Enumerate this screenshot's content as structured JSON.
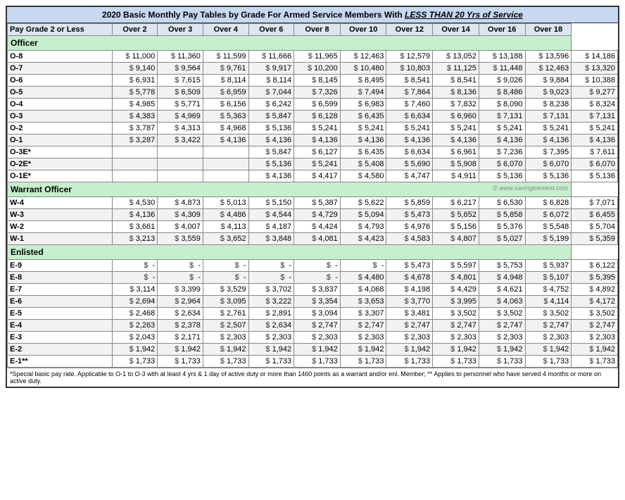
{
  "title": {
    "main": "2020 Basic Monthly Pay Tables by Grade For Armed Service Members",
    "highlight": "LESS THAN 20 Yrs of Service"
  },
  "columns": [
    "Pay Grade 2 or Less",
    "Over 2",
    "Over 3",
    "Over 4",
    "Over 6",
    "Over 8",
    "Over 10",
    "Over 12",
    "Over 14",
    "Over 16",
    "Over 18"
  ],
  "sections": {
    "officer": {
      "label": "Officer",
      "rows": [
        {
          "grade": "O-8",
          "values": [
            "11,000",
            "11,360",
            "11,599",
            "11,666",
            "11,965",
            "12,463",
            "12,579",
            "13,052",
            "13,188",
            "13,596",
            "14,186"
          ]
        },
        {
          "grade": "O-7",
          "values": [
            "9,140",
            "9,564",
            "9,761",
            "9,917",
            "10,200",
            "10,480",
            "10,803",
            "11,125",
            "11,448",
            "12,463",
            "13,320"
          ]
        },
        {
          "grade": "O-6",
          "values": [
            "6,931",
            "7,615",
            "8,114",
            "8,114",
            "8,145",
            "8,495",
            "8,541",
            "8,541",
            "9,026",
            "9,884",
            "10,388"
          ]
        },
        {
          "grade": "O-5",
          "values": [
            "5,778",
            "6,509",
            "6,959",
            "7,044",
            "7,326",
            "7,494",
            "7,864",
            "8,136",
            "8,486",
            "9,023",
            "9,277"
          ]
        },
        {
          "grade": "O-4",
          "values": [
            "4,985",
            "5,771",
            "6,156",
            "6,242",
            "6,599",
            "6,983",
            "7,460",
            "7,832",
            "8,090",
            "8,238",
            "8,324"
          ]
        },
        {
          "grade": "O-3",
          "values": [
            "4,383",
            "4,969",
            "5,363",
            "5,847",
            "6,128",
            "6,435",
            "6,634",
            "6,960",
            "7,131",
            "7,131",
            "7,131"
          ]
        },
        {
          "grade": "O-2",
          "values": [
            "3,787",
            "4,313",
            "4,968",
            "5,136",
            "5,241",
            "5,241",
            "5,241",
            "5,241",
            "5,241",
            "5,241",
            "5,241"
          ]
        },
        {
          "grade": "O-1",
          "values": [
            "3,287",
            "3,422",
            "4,136",
            "4,136",
            "4,136",
            "4,136",
            "4,136",
            "4,136",
            "4,136",
            "4,136",
            "4,136"
          ]
        },
        {
          "grade": "O-3E*",
          "values": [
            "",
            "",
            "",
            "5,847",
            "6,127",
            "6,435",
            "6,634",
            "6,961",
            "7,236",
            "7,395",
            "7,611"
          ]
        },
        {
          "grade": "O-2E*",
          "values": [
            "",
            "",
            "",
            "5,136",
            "5,241",
            "5,408",
            "5,690",
            "5,908",
            "6,070",
            "6,070",
            "6,070"
          ]
        },
        {
          "grade": "O-1E*",
          "values": [
            "",
            "",
            "",
            "4,136",
            "4,417",
            "4,580",
            "4,747",
            "4,911",
            "5,136",
            "5,136",
            "5,136"
          ]
        }
      ]
    },
    "warrant": {
      "label": "Warrant Officer",
      "watermark": "© www.savingtoinvest.com",
      "rows": [
        {
          "grade": "W-4",
          "values": [
            "4,530",
            "4,873",
            "5,013",
            "5,150",
            "5,387",
            "5,622",
            "5,859",
            "6,217",
            "6,530",
            "6,828",
            "7,071"
          ]
        },
        {
          "grade": "W-3",
          "values": [
            "4,136",
            "4,309",
            "4,486",
            "4,544",
            "4,729",
            "5,094",
            "5,473",
            "5,652",
            "5,858",
            "6,072",
            "6,455"
          ]
        },
        {
          "grade": "W-2",
          "values": [
            "3,661",
            "4,007",
            "4,113",
            "4,187",
            "4,424",
            "4,793",
            "4,976",
            "5,156",
            "5,376",
            "5,548",
            "5,704"
          ]
        },
        {
          "grade": "W-1",
          "values": [
            "3,213",
            "3,559",
            "3,652",
            "3,848",
            "4,081",
            "4,423",
            "4,583",
            "4,807",
            "5,027",
            "5,199",
            "5,359"
          ]
        }
      ]
    },
    "enlisted": {
      "label": "Enlisted",
      "rows": [
        {
          "grade": "E-9",
          "values": [
            "-",
            "-",
            "-",
            "-",
            "-",
            "-",
            "5,473",
            "5,597",
            "5,753",
            "5,937",
            "6,122"
          ]
        },
        {
          "grade": "E-8",
          "values": [
            "-",
            "-",
            "-",
            "-",
            "-",
            "4,480",
            "4,678",
            "4,801",
            "4,948",
            "5,107",
            "5,395"
          ]
        },
        {
          "grade": "E-7",
          "values": [
            "3,114",
            "3,399",
            "3,529",
            "3,702",
            "3,837",
            "4,068",
            "4,198",
            "4,429",
            "4,621",
            "4,752",
            "4,892"
          ]
        },
        {
          "grade": "E-6",
          "values": [
            "2,694",
            "2,964",
            "3,095",
            "3,222",
            "3,354",
            "3,653",
            "3,770",
            "3,995",
            "4,063",
            "4,114",
            "4,172"
          ]
        },
        {
          "grade": "E-5",
          "values": [
            "2,468",
            "2,634",
            "2,761",
            "2,891",
            "3,094",
            "3,307",
            "3,481",
            "3,502",
            "3,502",
            "3,502",
            "3,502"
          ]
        },
        {
          "grade": "E-4",
          "values": [
            "2,263",
            "2,378",
            "2,507",
            "2,634",
            "2,747",
            "2,747",
            "2,747",
            "2,747",
            "2,747",
            "2,747",
            "2,747"
          ]
        },
        {
          "grade": "E-3",
          "values": [
            "2,043",
            "2,171",
            "2,303",
            "2,303",
            "2,303",
            "2,303",
            "2,303",
            "2,303",
            "2,303",
            "2,303",
            "2,303"
          ]
        },
        {
          "grade": "E-2",
          "values": [
            "1,942",
            "1,942",
            "1,942",
            "1,942",
            "1,942",
            "1,942",
            "1,942",
            "1,942",
            "1,942",
            "1,942",
            "1,942"
          ]
        },
        {
          "grade": "E-1**",
          "values": [
            "1,733",
            "1,733",
            "1,733",
            "1,733",
            "1,733",
            "1,733",
            "1,733",
            "1,733",
            "1,733",
            "1,733",
            "1,733"
          ]
        }
      ]
    }
  },
  "footnote": "*Special basic pay rate. Applicable to O-1 to O-3 with at least 4 yrs & 1 day of active duty or more than 1460 points as a warrant and/or enl. Member; ** Applies to personnel who have served 4 months or more on active duty."
}
